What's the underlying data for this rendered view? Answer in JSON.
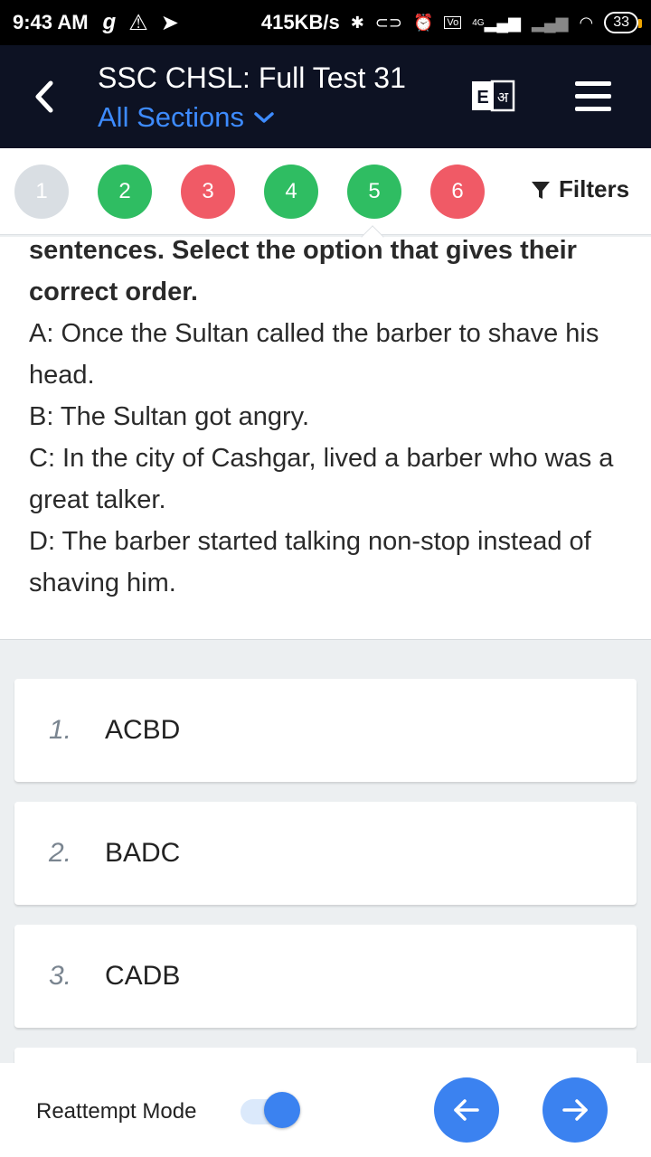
{
  "status_bar": {
    "time": "9:43 AM",
    "speed": "415KB/s",
    "battery": "33",
    "network": "4G"
  },
  "header": {
    "title": "SSC CHSL: Full Test 31",
    "subtitle": "All Sections"
  },
  "question_nav": {
    "bubbles": [
      {
        "label": "1",
        "status": "gray"
      },
      {
        "label": "2",
        "status": "green"
      },
      {
        "label": "3",
        "status": "red"
      },
      {
        "label": "4",
        "status": "green"
      },
      {
        "label": "5",
        "status": "green"
      },
      {
        "label": "6",
        "status": "red"
      }
    ],
    "filters_label": "Filters"
  },
  "question": {
    "instruction_line1": "sentences. Select the option that gives their",
    "instruction_line2": "correct order.",
    "sentences": [
      "A: Once the Sultan called the barber to shave his head.",
      "B: The Sultan got angry.",
      "C: In the city of Cashgar, lived a barber who was a great talker.",
      "D: The barber started talking non-stop instead of shaving him."
    ]
  },
  "options": [
    {
      "number": "1.",
      "text": "ACBD"
    },
    {
      "number": "2.",
      "text": "BADC"
    },
    {
      "number": "3.",
      "text": "CADB"
    }
  ],
  "footer": {
    "reattempt_label": "Reattempt Mode",
    "reattempt_on": true
  },
  "colors": {
    "appbar": "#0d1223",
    "accent": "#3b82f0",
    "green": "#2fbd62",
    "red": "#f05a66",
    "gray": "#d9dee3"
  }
}
